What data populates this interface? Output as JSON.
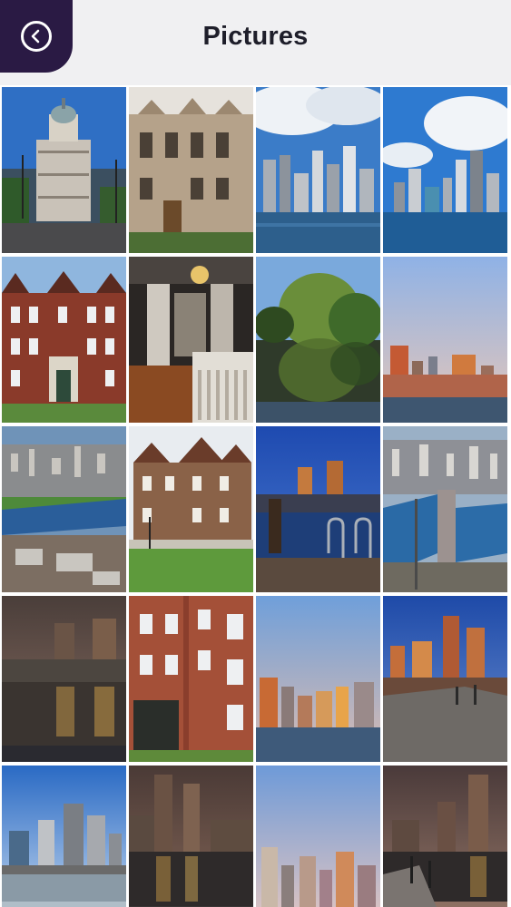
{
  "header": {
    "title": "Pictures",
    "back_icon": "chevron-left-icon",
    "back_color": "#2a1a44"
  },
  "gallery": {
    "photos": [
      {
        "subject": "ornate-domed-building"
      },
      {
        "subject": "brick-mansion-facade"
      },
      {
        "subject": "city-skyline-cloudy-harbor"
      },
      {
        "subject": "city-skyline-clouds-water"
      },
      {
        "subject": "colonial-brick-house"
      },
      {
        "subject": "ornate-hallway-interior"
      },
      {
        "subject": "willow-tree-reflection"
      },
      {
        "subject": "skyline-dusk-waterfront"
      },
      {
        "subject": "aerial-city-river"
      },
      {
        "subject": "victorian-house-lawn"
      },
      {
        "subject": "towers-night-harbor-rail"
      },
      {
        "subject": "aerial-city-bridges"
      },
      {
        "subject": "night-skyline-reflection-chain"
      },
      {
        "subject": "brick-rowhouses-street"
      },
      {
        "subject": "skyline-sunset-water"
      },
      {
        "subject": "pier-night-skyline"
      },
      {
        "subject": "skyline-sky-river"
      },
      {
        "subject": "night-towers-reflection"
      },
      {
        "subject": "skyline-pink-sky"
      },
      {
        "subject": "pier-towers-dusk"
      }
    ]
  }
}
